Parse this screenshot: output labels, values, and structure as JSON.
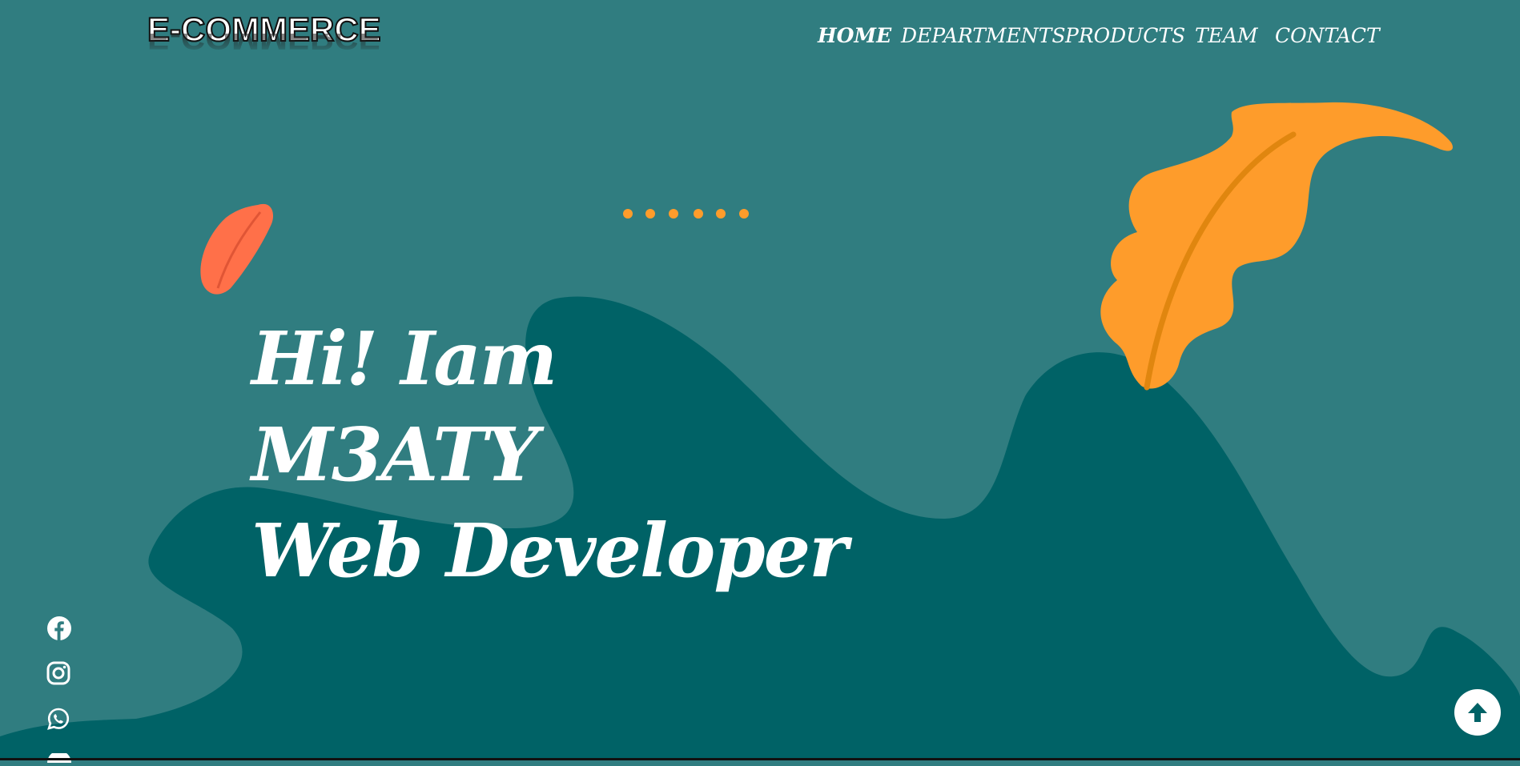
{
  "header": {
    "logo_text": "E-COMMERCE",
    "nav": [
      {
        "label": "HOME",
        "active": true
      },
      {
        "label": "DEPARTMENTS",
        "active": false
      },
      {
        "label": "PRODUCTS",
        "active": false
      },
      {
        "label": "TEAM",
        "active": false
      },
      {
        "label": "CONTACT",
        "active": false
      }
    ]
  },
  "hero": {
    "line1": "Hi! Iam",
    "line2": "M3ATY",
    "line3": "Web Developer"
  },
  "social_icons": [
    "facebook-icon",
    "instagram-icon",
    "whatsapp-icon"
  ],
  "scroll_top_icon": "arrow-up-icon",
  "colors": {
    "background": "#307d80",
    "wave": "#006266",
    "leaf_orange": "#fe9c2b",
    "leaf_red": "#ff7049",
    "text": "#ffffff"
  }
}
